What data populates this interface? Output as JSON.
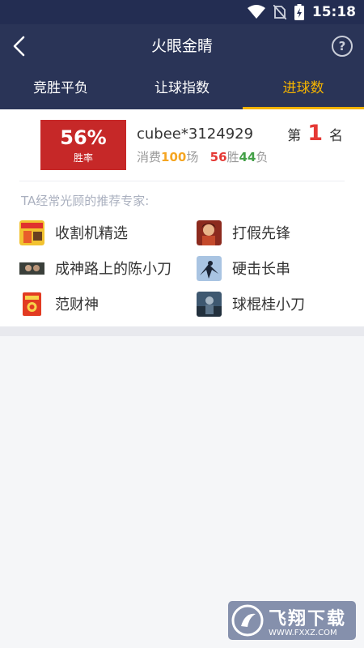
{
  "status_bar": {
    "time": "15:18"
  },
  "app_bar": {
    "title": "火眼金睛",
    "help_label": "?"
  },
  "tabs": [
    {
      "label": "竞胜平负",
      "active": false
    },
    {
      "label": "让球指数",
      "active": false
    },
    {
      "label": "进球数",
      "active": true
    }
  ],
  "profile": {
    "win_rate": "56%",
    "win_rate_label": "胜率",
    "username": "cubee*3124929",
    "spend_prefix": "消费",
    "spend_count": "100",
    "spend_unit": "场",
    "wins": "56",
    "wins_unit": "胜",
    "losses": "44",
    "losses_unit": "负",
    "rank_prefix": "第",
    "rank": "1",
    "rank_suffix": "名"
  },
  "experts_label": "TA经常光顾的推荐专家:",
  "experts": [
    {
      "name": "收割机精选"
    },
    {
      "name": "打假先锋"
    },
    {
      "name": "成神路上的陈小刀"
    },
    {
      "name": "硬击长串"
    },
    {
      "name": "范财神"
    },
    {
      "name": "球棍桂小刀"
    }
  ],
  "watermark": {
    "brand": "飞翔下载",
    "url": "WWW.FXXZ.COM"
  },
  "colors": {
    "header": "#2a3457",
    "accent": "#f5b400",
    "rate_box": "#c62828"
  }
}
